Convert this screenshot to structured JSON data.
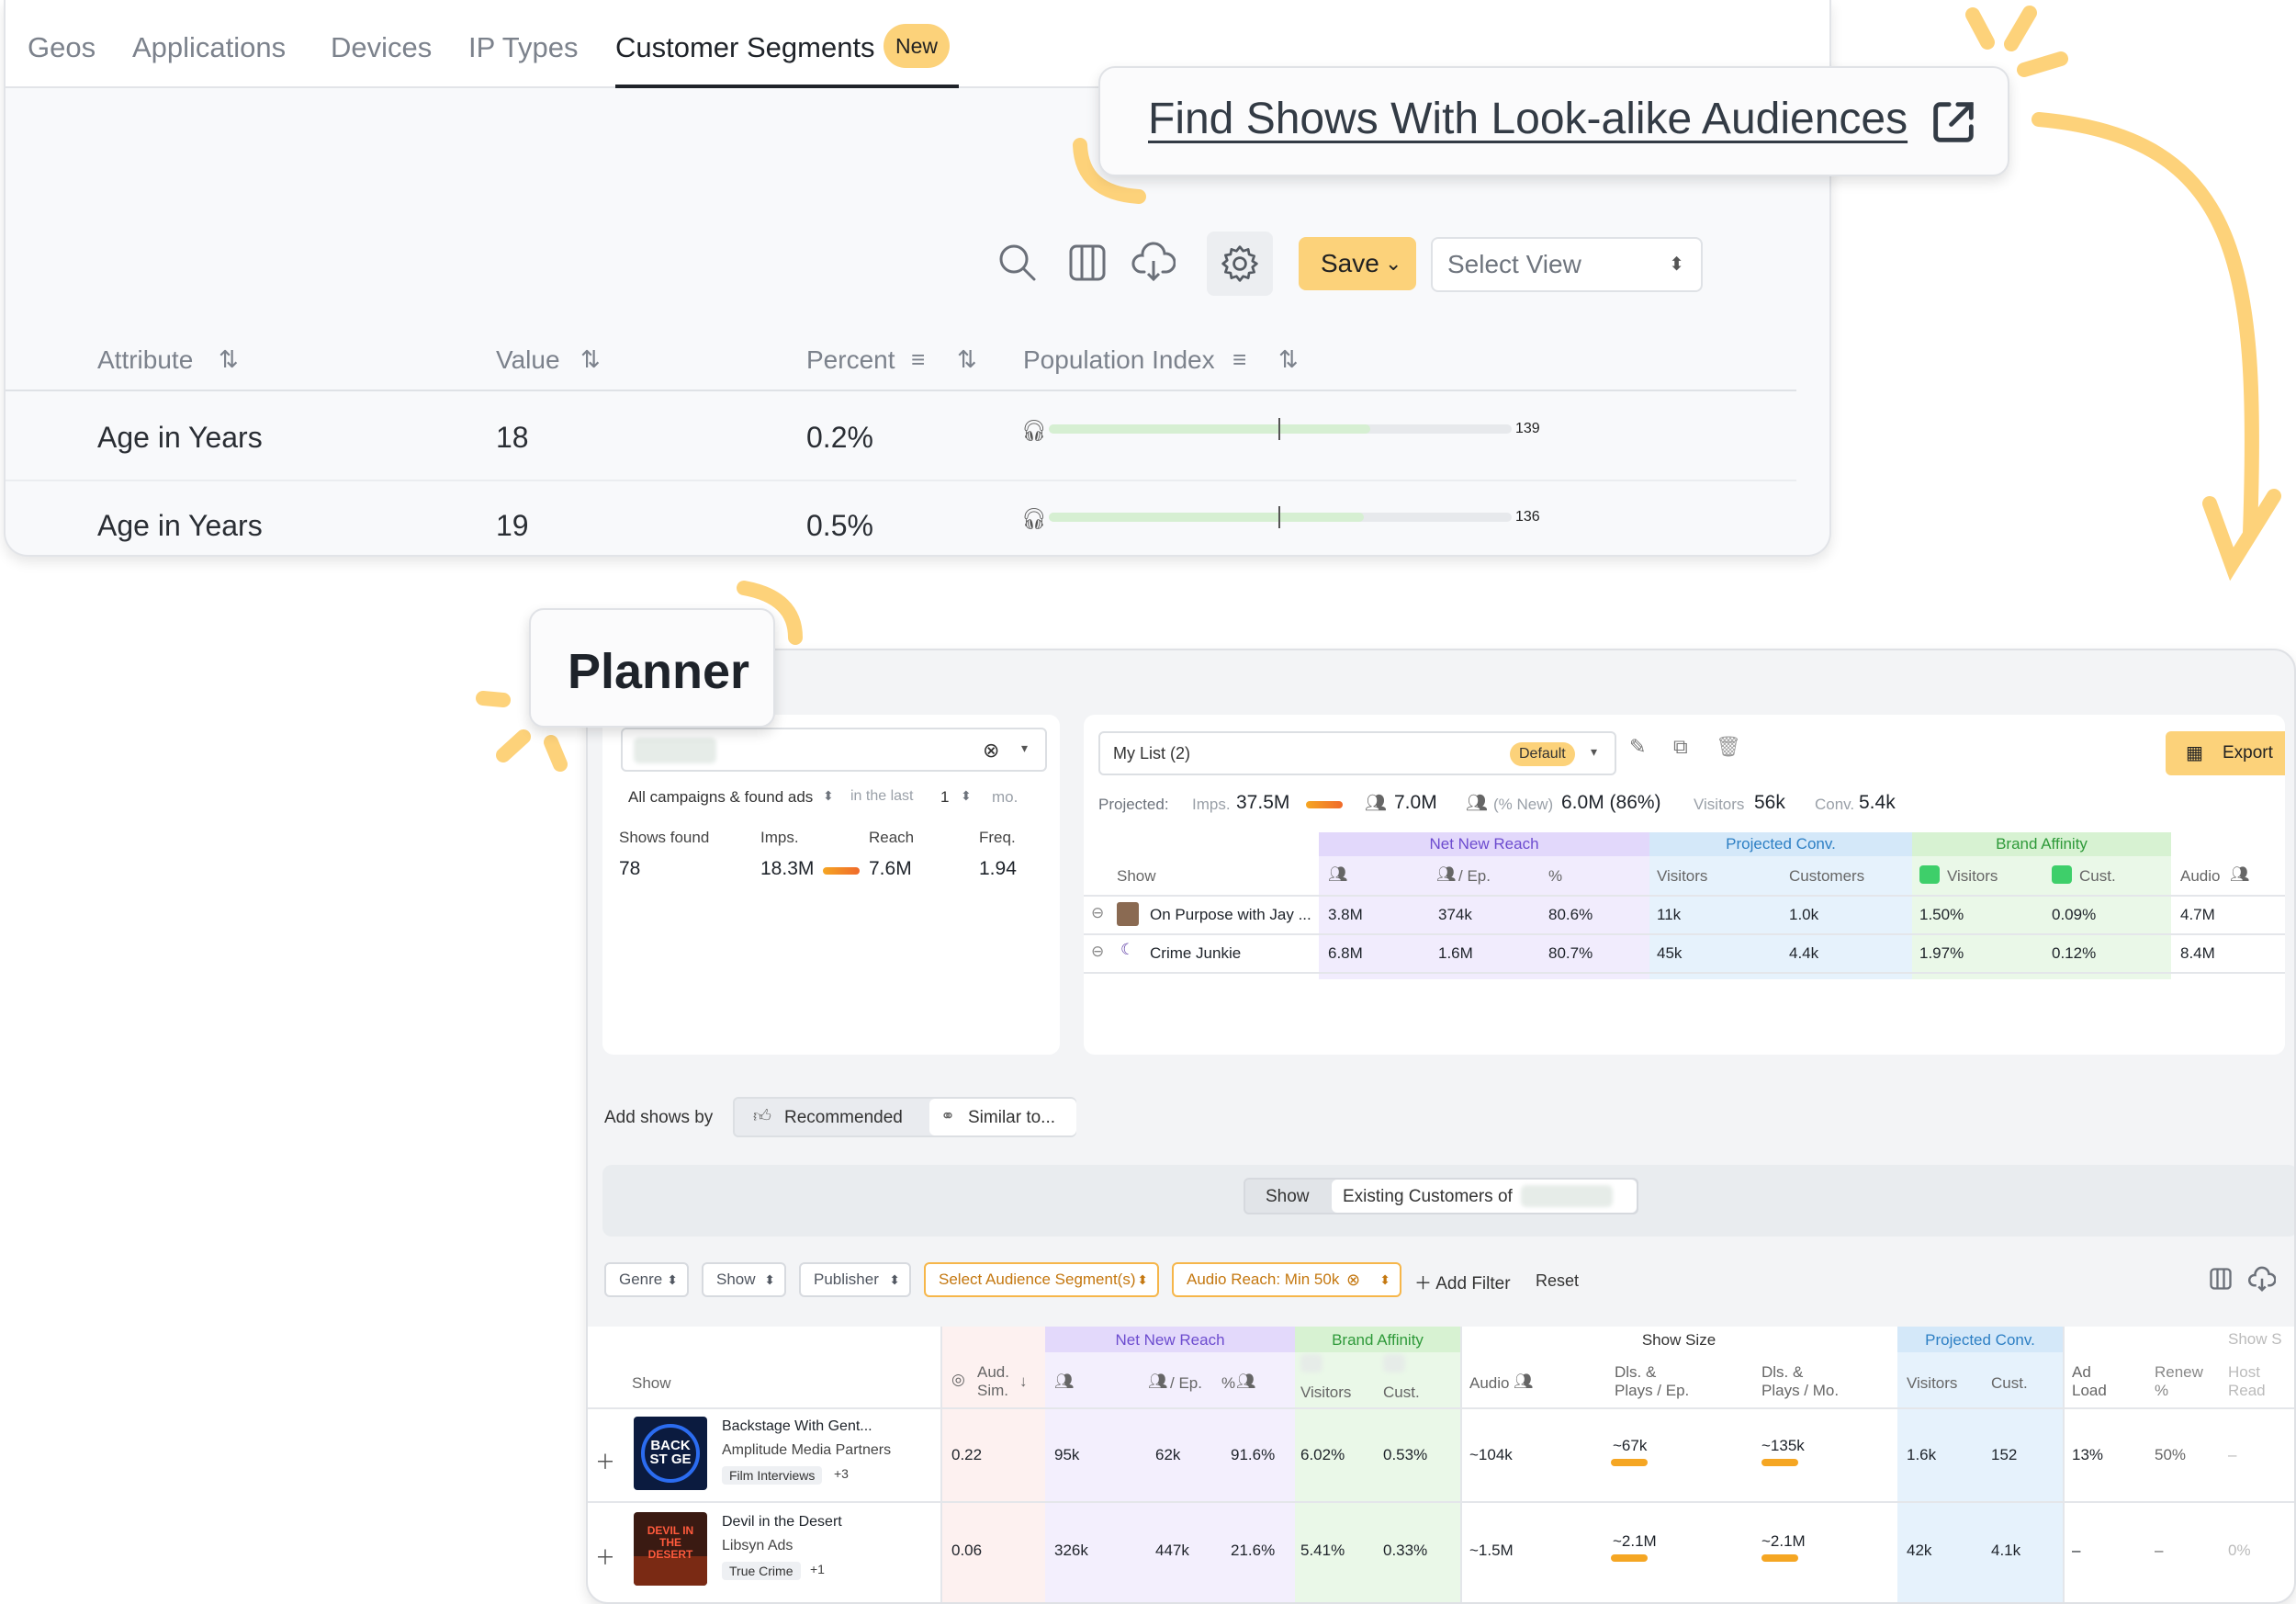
{
  "top": {
    "tabs": [
      {
        "label": "Geos"
      },
      {
        "label": "Applications"
      },
      {
        "label": "Devices"
      },
      {
        "label": "IP Types"
      },
      {
        "label": "Customer Segments",
        "badge": "New",
        "active": true
      }
    ],
    "toolbar": {
      "save_label": "Save",
      "select_view_placeholder": "Select View"
    },
    "table": {
      "headers": [
        "Attribute",
        "Value",
        "Percent",
        "Population Index"
      ],
      "rows": [
        {
          "attribute": "Age in Years",
          "value": "18",
          "percent": "0.2%",
          "index": "139",
          "index_num": 139
        },
        {
          "attribute": "Age in Years",
          "value": "19",
          "percent": "0.5%",
          "index": "136",
          "index_num": 136
        }
      ]
    }
  },
  "callouts": {
    "find_shows": "Find Shows With Look-alike Audiences",
    "planner": "Planner"
  },
  "planner": {
    "left_card": {
      "filter_campaigns": "All campaigns & found ads",
      "in_the_last": "in the last",
      "period_value": "1",
      "period_unit": "mo.",
      "stats": [
        {
          "label": "Shows found",
          "value": "78"
        },
        {
          "label": "Imps.",
          "value": "18.3M"
        },
        {
          "label": "Reach",
          "value": "7.6M"
        },
        {
          "label": "Freq.",
          "value": "1.94"
        }
      ]
    },
    "list_card": {
      "list_name": "My List (2)",
      "default_badge": "Default",
      "export_label": "Export",
      "projected_label": "Projected:",
      "imps_label": "Imps.",
      "imps_value": "37.5M",
      "reach_value": "7.0M",
      "pct_new_label": "(% New)",
      "new_value": "6.0M (86%)",
      "visitors_label": "Visitors",
      "visitors_value": "56k",
      "conv_label": "Conv.",
      "conv_value": "5.4k",
      "groups": {
        "net_new_reach": "Net New Reach",
        "projected_conv": "Projected Conv.",
        "brand_affinity": "Brand Affinity"
      },
      "cols": {
        "show": "Show",
        "per_ep": "/ Ep.",
        "pct": "%",
        "visitors": "Visitors",
        "customers": "Customers",
        "cust": "Cust.",
        "audio": "Audio"
      },
      "rows": [
        {
          "show": "On Purpose with Jay ...",
          "reach": "3.8M",
          "per_ep": "374k",
          "pct": "80.6%",
          "visitors": "11k",
          "customers": "1.0k",
          "ba_visitors": "1.50%",
          "ba_cust": "0.09%",
          "audio": "4.7M"
        },
        {
          "show": "Crime Junkie",
          "reach": "6.8M",
          "per_ep": "1.6M",
          "pct": "80.7%",
          "visitors": "45k",
          "customers": "4.4k",
          "ba_visitors": "1.97%",
          "ba_cust": "0.12%",
          "audio": "8.4M"
        }
      ]
    },
    "add_shows": {
      "label": "Add shows by",
      "recommended": "Recommended",
      "similar": "Similar to..."
    },
    "segment_toggle": {
      "show": "Show",
      "existing": "Existing Customers of"
    },
    "filters": {
      "genre": "Genre",
      "show": "Show",
      "publisher": "Publisher",
      "audience_segment": "Select Audience Segment(s)",
      "audio_reach": "Audio Reach: Min 50k",
      "add_filter": "Add Filter",
      "reset": "Reset"
    },
    "results": {
      "groups": {
        "net_new_reach": "Net New Reach",
        "brand_affinity": "Brand Affinity",
        "show_size": "Show Size",
        "projected_conv": "Projected Conv.",
        "show_cut": "Show S"
      },
      "cols": {
        "show": "Show",
        "aud_sim_1": "Aud.",
        "aud_sim_2": "Sim.",
        "per_ep": "/ Ep.",
        "pct": "%",
        "visitors": "Visitors",
        "cust": "Cust.",
        "audio": "Audio",
        "dls_ep_1": "Dls. &",
        "dls_ep_2": "Plays / Ep.",
        "dls_mo_1": "Dls. &",
        "dls_mo_2": "Plays / Mo.",
        "pc_visitors": "Visitors",
        "pc_cust": "Cust.",
        "ad_load_1": "Ad",
        "ad_load_2": "Load",
        "renew_1": "Renew",
        "renew_2": "%",
        "host_1": "Host",
        "host_2": "Read"
      },
      "rows": [
        {
          "title": "Backstage With Gent...",
          "publisher": "Amplitude Media Partners",
          "tag": "Film Interviews",
          "more": "+3",
          "art_text": "BACK ST GE",
          "aud_sim": "0.22",
          "reach": "95k",
          "per_ep": "62k",
          "pct": "91.6%",
          "ba_visitors": "6.02%",
          "ba_cust": "0.53%",
          "audio": "~104k",
          "dls_ep": "~67k",
          "dls_mo": "~135k",
          "pc_visitors": "1.6k",
          "pc_cust": "152",
          "ad_load": "13%",
          "renew": "50%",
          "host": "–"
        },
        {
          "title": "Devil in the Desert",
          "publisher": "Libsyn Ads",
          "tag": "True Crime",
          "more": "+1",
          "art_text": "DEVIL IN THE DESERT",
          "aud_sim": "0.06",
          "reach": "326k",
          "per_ep": "447k",
          "pct": "21.6%",
          "ba_visitors": "5.41%",
          "ba_cust": "0.33%",
          "audio": "~1.5M",
          "dls_ep": "~2.1M",
          "dls_mo": "~2.1M",
          "pc_visitors": "42k",
          "pc_cust": "4.1k",
          "ad_load": "–",
          "renew": "–",
          "host": "0%"
        }
      ]
    }
  },
  "colors": {
    "accent": "#fcd27a",
    "purple_band": "#f1ecfd",
    "blue_band": "#e6f2fc",
    "green_band": "#eaf8e8",
    "pink_band": "#fdf1f0",
    "orange": "#f5a623",
    "callout_stroke": "#fdd27a"
  }
}
